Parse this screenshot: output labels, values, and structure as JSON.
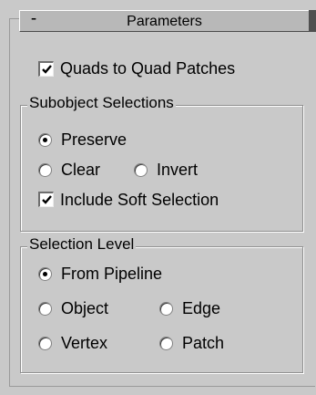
{
  "rollout": {
    "toggle": "-",
    "title": "Parameters"
  },
  "quads": {
    "label": "Quads to Quad Patches",
    "checked": true
  },
  "subobject": {
    "title": "Subobject Selections",
    "options": [
      {
        "label": "Preserve",
        "selected": true
      },
      {
        "label": "Clear",
        "selected": false
      },
      {
        "label": "Invert",
        "selected": false
      }
    ],
    "soft": {
      "label": "Include Soft Selection",
      "checked": true
    }
  },
  "level": {
    "title": "Selection Level",
    "options": [
      {
        "label": "From Pipeline",
        "selected": true
      },
      {
        "label": "Object",
        "selected": false
      },
      {
        "label": "Edge",
        "selected": false
      },
      {
        "label": "Vertex",
        "selected": false
      },
      {
        "label": "Patch",
        "selected": false
      }
    ]
  },
  "colors": {
    "panel": "#c9c9c9",
    "header": "#b8b8b8"
  }
}
